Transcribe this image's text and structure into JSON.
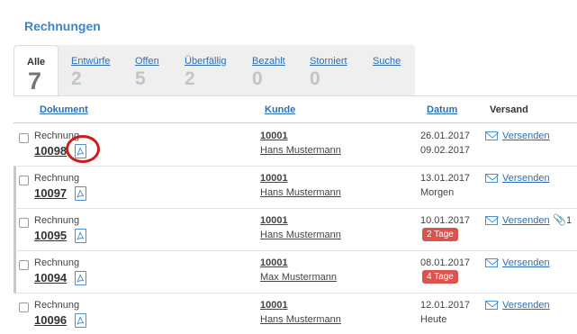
{
  "header": {
    "title": "Rechnungen"
  },
  "tabs": [
    {
      "label": "Alle",
      "count": "7",
      "active": true
    },
    {
      "label": "Entwürfe",
      "count": "2",
      "active": false
    },
    {
      "label": "Offen",
      "count": "5",
      "active": false
    },
    {
      "label": "Überfällig",
      "count": "2",
      "active": false
    },
    {
      "label": "Bezahlt",
      "count": "0",
      "active": false
    },
    {
      "label": "Storniert",
      "count": "0",
      "active": false
    },
    {
      "label": "Suche",
      "count": "",
      "active": false
    }
  ],
  "columns": {
    "dokument": "Dokument",
    "kunde": "Kunde",
    "datum": "Datum",
    "versand": "Versand"
  },
  "rows": [
    {
      "type": "Rechnung",
      "number": "10098",
      "customer_number": "10001",
      "customer_name": "Hans Mustermann",
      "date": "26.01.2017",
      "due": "09.02.2017",
      "badge": "",
      "send": "Versenden",
      "attachments": ""
    },
    {
      "type": "Rechnung",
      "number": "10097",
      "customer_number": "10001",
      "customer_name": "Hans Mustermann",
      "date": "13.01.2017",
      "due": "Morgen",
      "badge": "",
      "send": "Versenden",
      "attachments": ""
    },
    {
      "type": "Rechnung",
      "number": "10095",
      "customer_number": "10001",
      "customer_name": "Hans Mustermann",
      "date": "10.01.2017",
      "due": "",
      "badge": "2 Tage",
      "send": "Versenden",
      "attachments": "1"
    },
    {
      "type": "Rechnung",
      "number": "10094",
      "customer_number": "10001",
      "customer_name": "Max Mustermann",
      "date": "08.01.2017",
      "due": "",
      "badge": "4 Tage",
      "send": "Versenden",
      "attachments": ""
    },
    {
      "type": "Rechnung",
      "number": "10096",
      "customer_number": "10001",
      "customer_name": "Hans Mustermann",
      "date": "12.01.2017",
      "due": "Heute",
      "badge": "",
      "send": "Versenden",
      "attachments": ""
    }
  ],
  "icons": {
    "pdf": "pdf-file-icon",
    "mail": "envelope-icon",
    "attachment": "paperclip-icon"
  },
  "colors": {
    "link": "#2a6fb8",
    "overdue_badge": "#d9534f",
    "highlight_ring": "#d11a1a"
  }
}
